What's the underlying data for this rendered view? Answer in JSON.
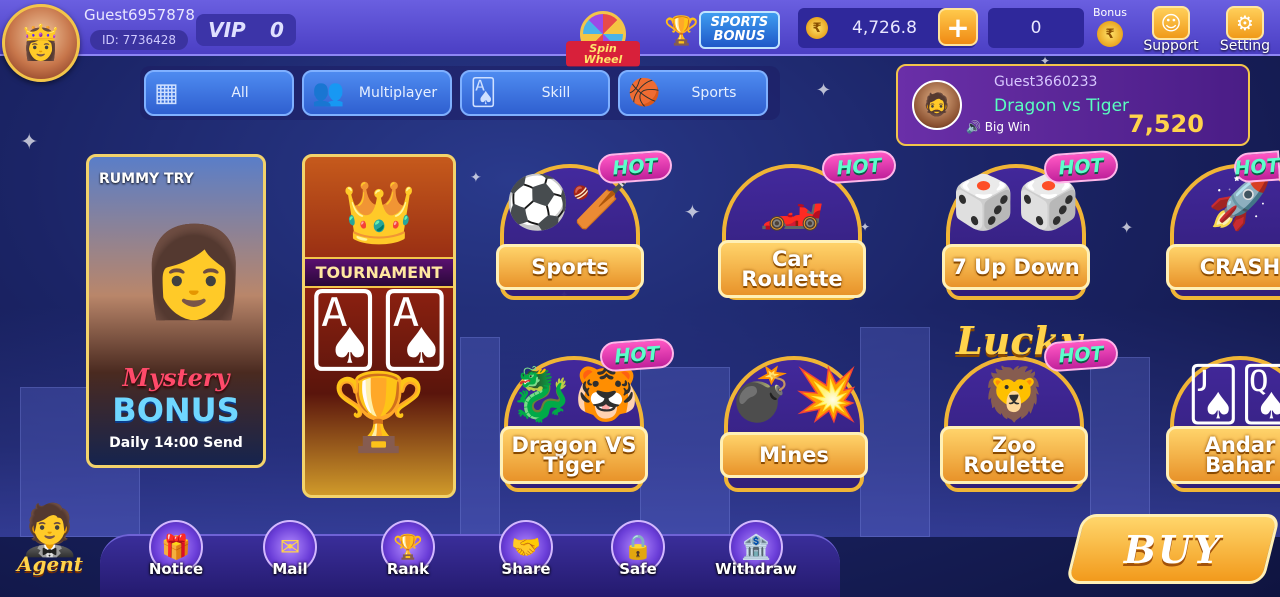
{
  "colors": {
    "accent": "#f3c54a",
    "topbar": "#5a4fd6",
    "hot_bg": "#e63bb0",
    "hot_text": "#5cffcb",
    "winner_game": "#59ffc0"
  },
  "header": {
    "username": "Guest6957878",
    "user_id": "ID: 7736428",
    "vip_label": "VIP",
    "vip_level": "0",
    "spin_wheel": "Spin Wheel",
    "sports_bonus": "SPORTS BONUS",
    "balance": "4,726.8",
    "add_label": "+",
    "bonus_value": "0",
    "bonus_label": "Bonus",
    "support_label": "Support",
    "setting_label": "Setting"
  },
  "tabs": [
    {
      "label": "All",
      "icon": "grid-icon"
    },
    {
      "label": "Multiplayer",
      "icon": "people-icon"
    },
    {
      "label": "Skill",
      "icon": "cards-icon"
    },
    {
      "label": "Sports",
      "icon": "ball-icon"
    }
  ],
  "winner": {
    "name": "Guest3660233",
    "game": "Dragon vs Tiger",
    "badge": "Big Win",
    "amount": "7,520"
  },
  "promos": {
    "rummy": {
      "brand": "RUMMY TRY",
      "line1": "Mystery",
      "line2": "BONUS",
      "line3": "Daily 14:00 Send"
    },
    "tournament": {
      "label": "TOURNAMENT"
    }
  },
  "games": [
    {
      "name": "Sports",
      "hot": "HOT"
    },
    {
      "name": "Car Roulette",
      "hot": "HOT"
    },
    {
      "name": "7 Up Down",
      "hot": "HOT"
    },
    {
      "name": "CRASH",
      "hot": "HOT"
    },
    {
      "name": "Dragon VS Tiger",
      "hot": "HOT"
    },
    {
      "name": "Mines"
    },
    {
      "name": "Zoo Roulette",
      "hot": "HOT",
      "extra": "Lucky"
    },
    {
      "name": "Andar Bahar"
    }
  ],
  "nav": [
    {
      "label": "Notice",
      "icon": "gift-icon"
    },
    {
      "label": "Mail",
      "icon": "mail-icon"
    },
    {
      "label": "Rank",
      "icon": "trophy-icon"
    },
    {
      "label": "Share",
      "icon": "handshake-icon"
    },
    {
      "label": "Safe",
      "icon": "safe-icon"
    },
    {
      "label": "Withdraw",
      "icon": "withdraw-icon"
    }
  ],
  "agent_label": "Agent",
  "buy_label": "BUY"
}
